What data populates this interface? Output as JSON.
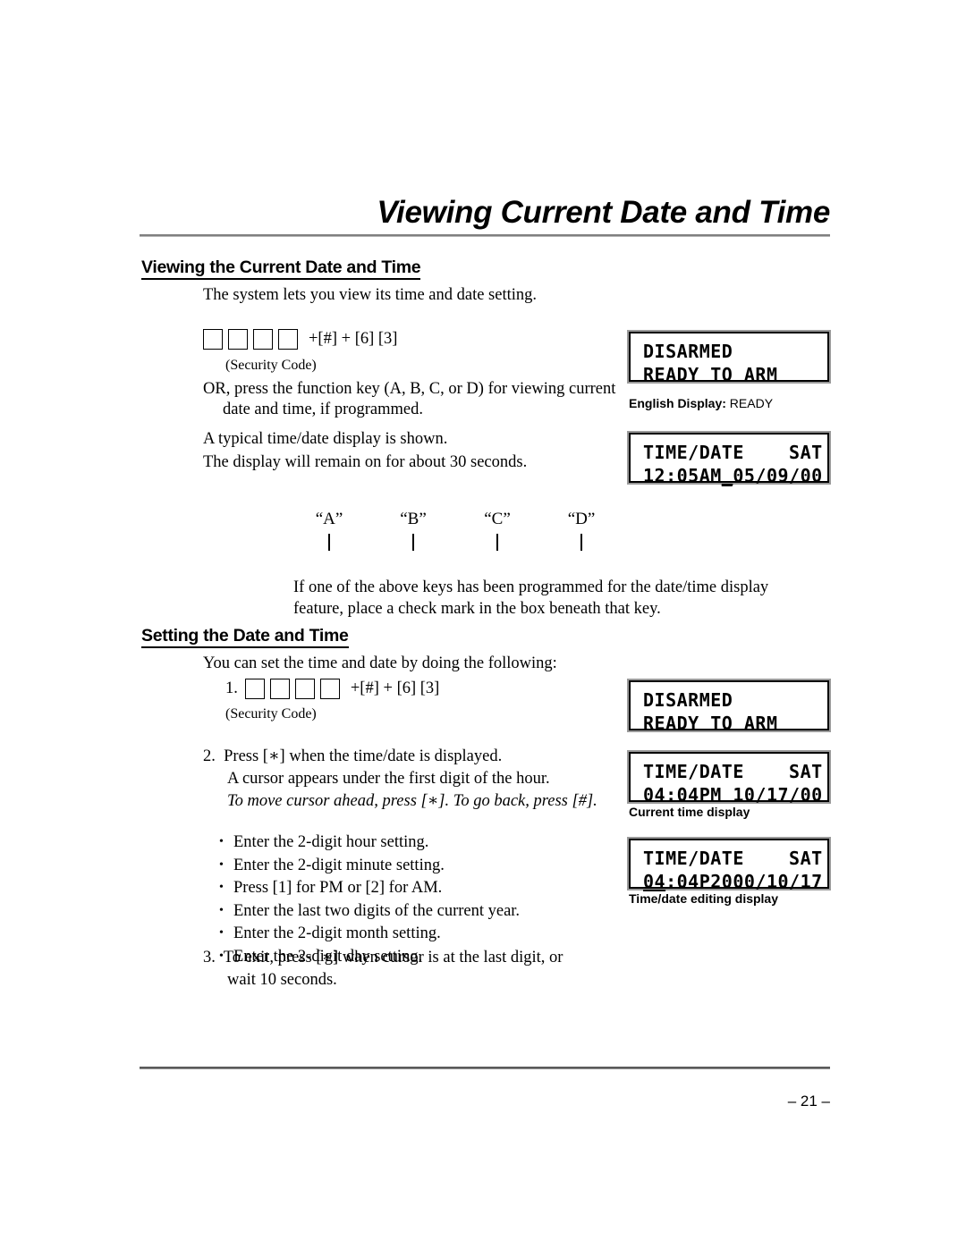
{
  "document": {
    "title": "Viewing Current Date and Time",
    "page_number": "– 21 –"
  },
  "sections": {
    "viewing": {
      "heading": "Viewing the Current Date and Time",
      "intro": "The system lets you view its time and date setting.",
      "code_entry": {
        "box_count": 4,
        "keys": "+[#] + [6] [3]",
        "caption": "(Security Code)"
      },
      "or_press": "OR, press the function key (A, B, C, or D) for viewing current date and time, if programmed.",
      "typical": "A typical time/date display is shown.",
      "remain": "The display will remain on for about 30 seconds.",
      "function_keys": [
        {
          "label": "“A”"
        },
        {
          "label": "“B”"
        },
        {
          "label": "“C”"
        },
        {
          "label": "“D”"
        }
      ],
      "function_keys_note": "If one of the above keys has been programmed for the date/time display feature, place a check mark in the box beneath that key."
    },
    "setting": {
      "heading": "Setting the Date and Time",
      "intro": "You can set the time and date by doing the following:",
      "step1": {
        "number": "1.",
        "box_count": 4,
        "keys": "+[#] +  [6] [3]",
        "caption": "(Security Code)"
      },
      "step2": {
        "number": "2.",
        "line1": "Press [∗] when the time/date is displayed.",
        "line2": "A cursor appears under the first digit of the hour.",
        "line3_italic": "To move cursor ahead, press [∗]. To go back, press [#].",
        "bullets": [
          "Enter the 2-digit hour setting.",
          "Enter the 2-digit minute setting.",
          "Press [1] for PM or [2] for AM.",
          "Enter the last two digits of the current year.",
          "Enter the 2-digit month setting.",
          "Enter the 2-digit day setting."
        ]
      },
      "step3": {
        "number": "3.",
        "line1": "To exit, press [∗] when cursor is at the last digit, or",
        "line2": "wait 10 seconds."
      }
    }
  },
  "displays": [
    {
      "id": "lcd-1",
      "line1": "DISARMED",
      "line2": "READY TO ARM",
      "caption_bold": "English Display:",
      "caption_normal": " READY"
    },
    {
      "id": "lcd-2",
      "line1": "TIME/DATE    SAT",
      "line2_pre": "12:05AM",
      "line2_cursor": "_",
      "line2_post": "05/09/00"
    },
    {
      "id": "lcd-3",
      "line1": "DISARMED",
      "line2": "READY TO ARM"
    },
    {
      "id": "lcd-4",
      "line1": "TIME/DATE    SAT",
      "line2": "04:04PM 10/17/00",
      "caption": "Current time display"
    },
    {
      "id": "lcd-5",
      "line1": "TIME/DATE    SAT",
      "line2_cursor": "04",
      "line2_post": ":04P2000/10/17",
      "caption": "Time/date editing display"
    }
  ]
}
